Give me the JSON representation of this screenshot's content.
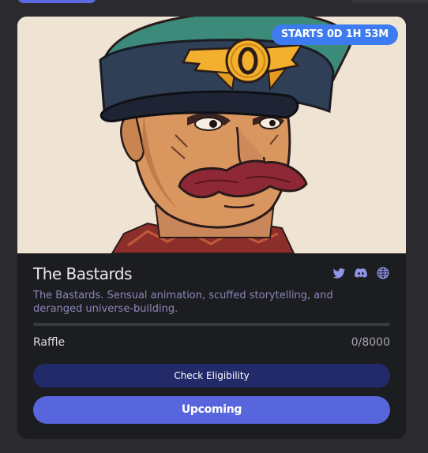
{
  "colors": {
    "accent": "#5866de",
    "badge": "#3d7cf0",
    "eligibility_button": "#222a69",
    "card_bg": "#1c1d21",
    "description_text": "#8c86b8"
  },
  "card": {
    "image_alt": "Illustration of a mustached officer in a peaked cap",
    "starts_badge": "STARTS 0D 1H 53M",
    "title": "The Bastards",
    "socials": [
      "twitter-icon",
      "discord-icon",
      "globe-icon"
    ],
    "description": "The Bastards. Sensual animation, scuffed storytelling, and deranged universe-building.",
    "progress": 0,
    "raffle_label": "Raffle",
    "raffle_count": "0/8000",
    "eligibility_button": "Check Eligibility",
    "status_button": "Upcoming"
  }
}
